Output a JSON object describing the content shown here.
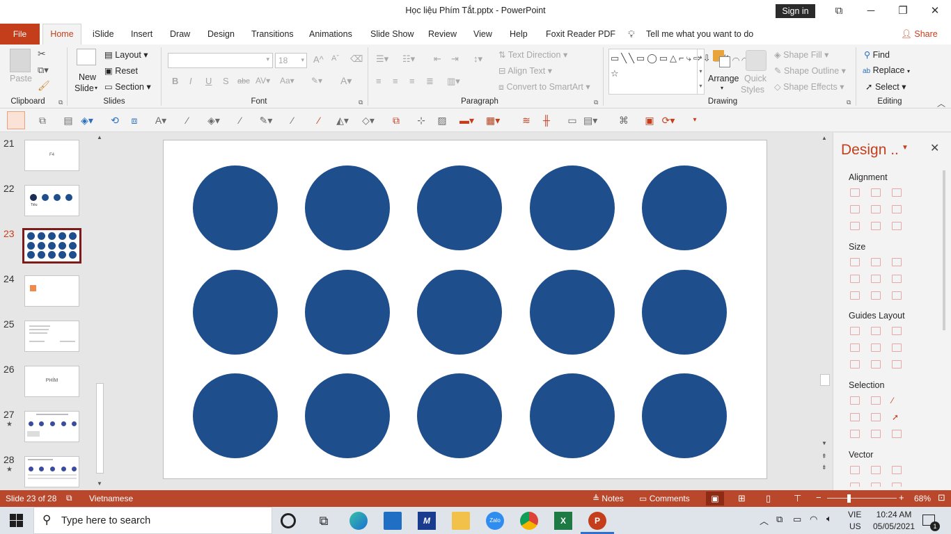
{
  "title_bar": {
    "title": "Học liệu Phím Tắt.pptx  -  PowerPoint",
    "sign_in": "Sign in",
    "restore_symbol": "⧉",
    "minimize_symbol": "─",
    "maximize_symbol": "❐",
    "close_symbol": "✕"
  },
  "tabs": [
    "File",
    "Home",
    "iSlide",
    "Insert",
    "Draw",
    "Design",
    "Transitions",
    "Animations",
    "Slide Show",
    "Review",
    "View",
    "Help",
    "Foxit Reader PDF"
  ],
  "tell_me": "Tell me what you want to do",
  "share": "Share",
  "ribbon": {
    "clipboard": {
      "paste": "Paste",
      "label": "Clipboard"
    },
    "slides": {
      "new_slide_1": "New",
      "new_slide_2": "Slide",
      "layout": "Layout",
      "reset": "Reset",
      "section": "Section",
      "label": "Slides"
    },
    "font": {
      "size": "18",
      "bold": "B",
      "italic": "I",
      "underline": "U",
      "shadow": "S",
      "strike": "abc",
      "label": "Font"
    },
    "paragraph": {
      "text_direction": "Text Direction",
      "align_text": "Align Text",
      "convert_smartart": "Convert to SmartArt",
      "label": "Paragraph"
    },
    "drawing": {
      "arrange": "Arrange",
      "quick_styles_1": "Quick",
      "quick_styles_2": "Styles",
      "shape_fill": "Shape Fill",
      "shape_outline": "Shape Outline",
      "shape_effects": "Shape Effects",
      "label": "Drawing"
    },
    "editing": {
      "find": "Find",
      "replace": "Replace",
      "select": "Select",
      "label": "Editing"
    }
  },
  "thumbnails": [
    {
      "num": "21",
      "star": "",
      "text": "F4"
    },
    {
      "num": "22",
      "star": "",
      "text": "Tiêu"
    },
    {
      "num": "23",
      "star": "",
      "text": ""
    },
    {
      "num": "24",
      "star": "",
      "text": ""
    },
    {
      "num": "25",
      "star": "",
      "text": ""
    },
    {
      "num": "26",
      "star": "",
      "text": "PHÍM"
    },
    {
      "num": "27",
      "star": "★",
      "text": ""
    },
    {
      "num": "28",
      "star": "★",
      "text": ""
    }
  ],
  "slide": {
    "circle_rows": 3,
    "circle_cols": 5,
    "circle_color": "#1f4e8c"
  },
  "design_pane": {
    "title": "Design ..",
    "sections": [
      "Alignment",
      "Size",
      "Guides Layout",
      "Selection",
      "Vector"
    ]
  },
  "status": {
    "slide_info": "Slide 23 of 28",
    "language": "Vietnamese",
    "notes": "Notes",
    "comments": "Comments",
    "zoom": "68%"
  },
  "taskbar": {
    "search_placeholder": "Type here to search",
    "lang_1": "VIE",
    "lang_2": "US",
    "time": "10:24 AM",
    "date": "05/05/2021",
    "notif_count": "1"
  },
  "colors": {
    "accent": "#c43e1c",
    "statusbar": "#b9472c",
    "shape": "#1f4e8c"
  }
}
